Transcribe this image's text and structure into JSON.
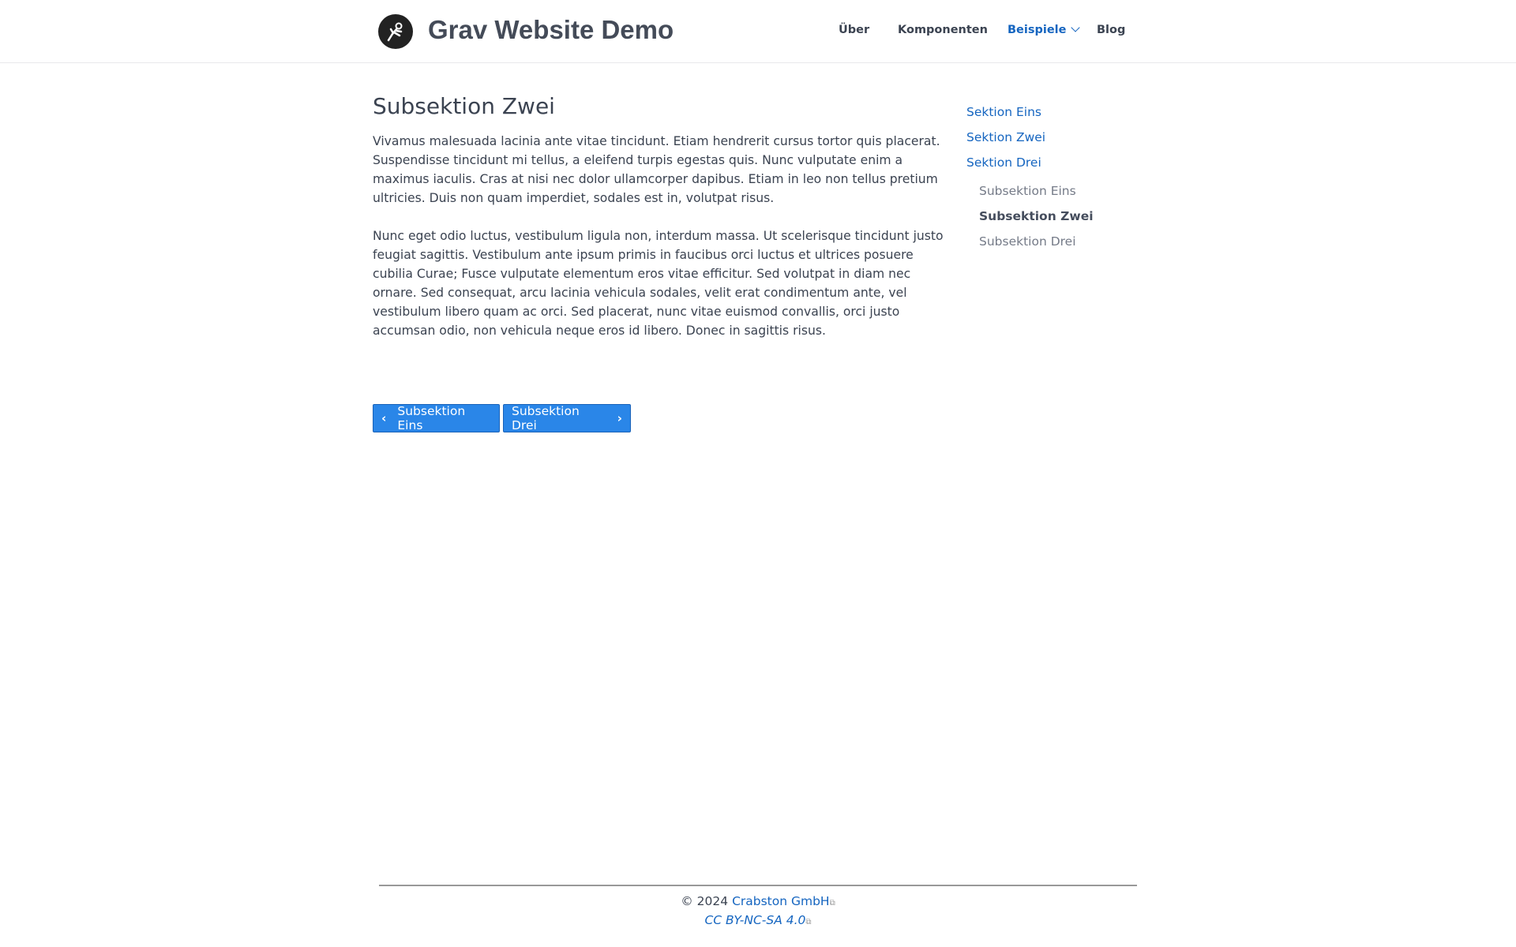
{
  "header": {
    "site_title": "Grav Website Demo",
    "nav": [
      {
        "label": "Über"
      },
      {
        "label": "Komponenten"
      },
      {
        "label": "Beispiele",
        "active": true
      },
      {
        "label": "Blog"
      }
    ]
  },
  "main": {
    "title": "Subsektion Zwei",
    "paragraphs": [
      "Vivamus malesuada lacinia ante vitae tincidunt. Etiam hendrerit cursus tortor quis placerat. Suspendisse tincidunt mi tellus, a eleifend turpis egestas quis. Nunc vulputate enim a maximus iaculis. Cras at nisi nec dolor ullamcorper dapibus. Etiam in leo non tellus pretium ultricies. Duis non quam imperdiet, sodales est in, volutpat risus.",
      "Nunc eget odio luctus, vestibulum ligula non, interdum massa. Ut scelerisque tincidunt justo feugiat sagittis. Vestibulum ante ipsum primis in faucibus orci luctus et ultrices posuere cubilia Curae; Fusce vulputate elementum eros vitae efficitur. Sed volutpat in diam nec ornare. Sed consequat, arcu lacinia vehicula sodales, velit erat condimentum ante, vel vestibulum libero quam ac orci. Sed placerat, nunc vitae euismod convallis, orci justo accumsan odio, non vehicula neque eros id libero. Donec in sagittis risus."
    ],
    "prev_label": "Subsektion Eins",
    "next_label": "Subsektion Drei"
  },
  "toc": {
    "sections": [
      "Sektion Eins",
      "Sektion Zwei",
      "Sektion Drei"
    ],
    "subsections": [
      "Subsektion Eins",
      "Subsektion Zwei",
      "Subsektion Drei"
    ],
    "current": "Subsektion Zwei"
  },
  "footer": {
    "copyright": "© 2024",
    "company": "Crabston GmbH",
    "license": "CC BY-NC-SA 4.0"
  },
  "colors": {
    "accent": "#1565c0",
    "button": "#2a86e8"
  }
}
